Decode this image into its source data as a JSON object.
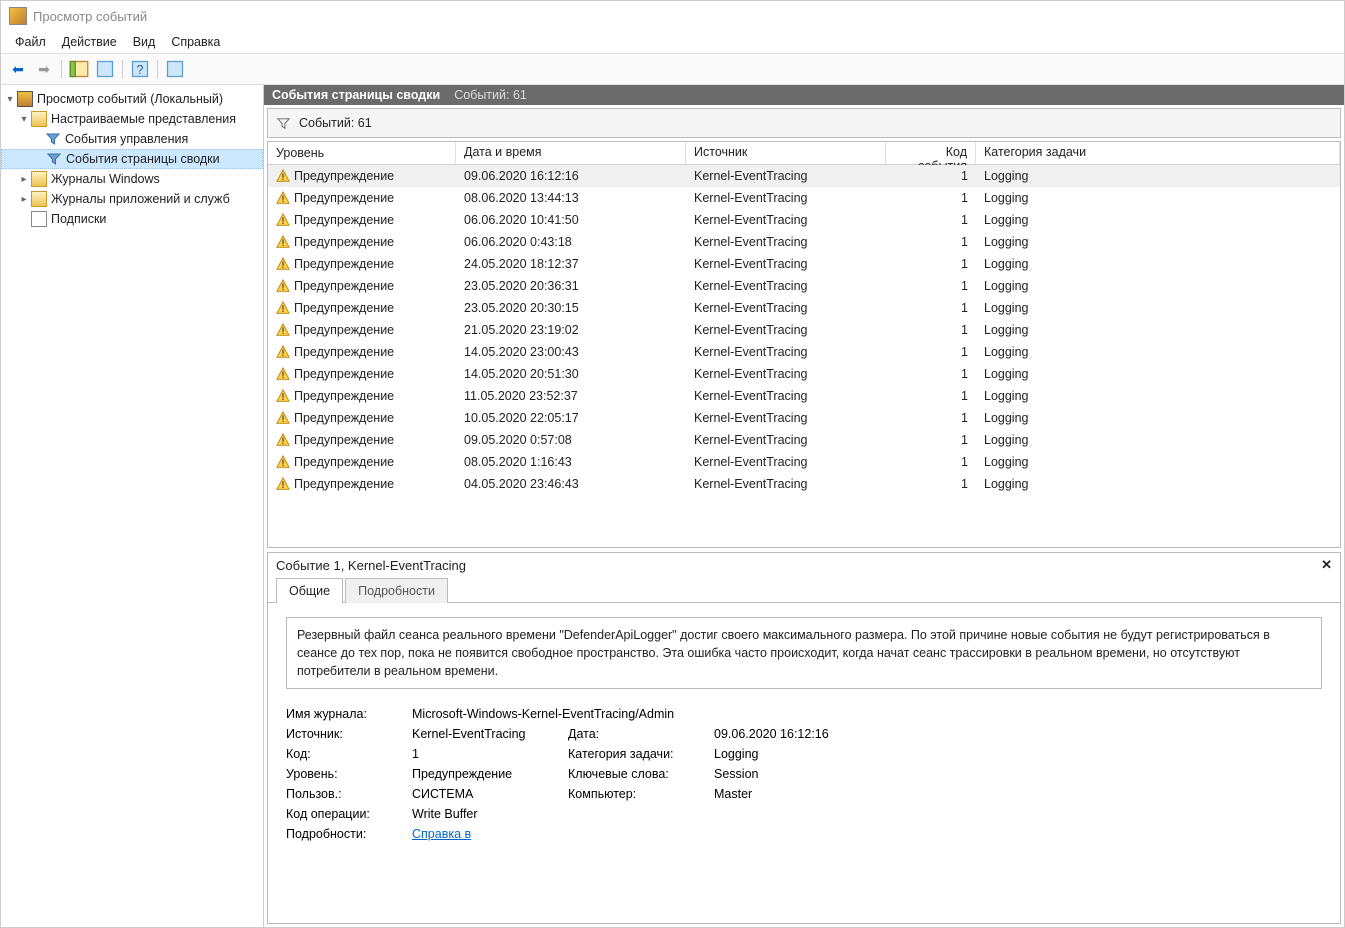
{
  "window_title": "Просмотр событий",
  "menu": [
    "Файл",
    "Действие",
    "Вид",
    "Справка"
  ],
  "tree": {
    "root": "Просмотр событий (Локальный)",
    "custom_views": "Настраиваемые представления",
    "admin_events": "События управления",
    "summary_events": "События страницы сводки",
    "win_logs": "Журналы Windows",
    "app_logs": "Журналы приложений и служб",
    "subscriptions": "Подписки"
  },
  "header": {
    "title": "События страницы сводки",
    "count_label": "Событий: 61"
  },
  "filter_bar_label": "Событий: 61",
  "columns": {
    "level": "Уровень",
    "datetime": "Дата и время",
    "source": "Источник",
    "code": "Код события",
    "category": "Категория задачи"
  },
  "level_warning": "Предупреждение",
  "source_common": "Kernel-EventTracing",
  "cat_common": "Logging",
  "code_common": "1",
  "rows": [
    {
      "dt": "09.06.2020 16:12:16"
    },
    {
      "dt": "08.06.2020 13:44:13"
    },
    {
      "dt": "06.06.2020 10:41:50"
    },
    {
      "dt": "06.06.2020 0:43:18"
    },
    {
      "dt": "24.05.2020 18:12:37"
    },
    {
      "dt": "23.05.2020 20:36:31"
    },
    {
      "dt": "23.05.2020 20:30:15"
    },
    {
      "dt": "21.05.2020 23:19:02"
    },
    {
      "dt": "14.05.2020 23:00:43"
    },
    {
      "dt": "14.05.2020 20:51:30"
    },
    {
      "dt": "11.05.2020 23:52:37"
    },
    {
      "dt": "10.05.2020 22:05:17"
    },
    {
      "dt": "09.05.2020 0:57:08"
    },
    {
      "dt": "08.05.2020 1:16:43"
    },
    {
      "dt": "04.05.2020 23:46:43"
    }
  ],
  "detail": {
    "title": "Событие 1, Kernel-EventTracing",
    "tab_general": "Общие",
    "tab_details": "Подробности",
    "description": "Резервный файл сеанса реального времени \"DefenderApiLogger\" достиг своего максимального размера. По этой причине новые события не будут регистрироваться в сеансе до тех пор, пока не появится свободное пространство. Эта ошибка часто происходит, когда начат сеанс трассировки в реальном времени, но отсутствуют потребители в реальном времени.",
    "labels": {
      "log_name": "Имя журнала:",
      "source": "Источник:",
      "date": "Дата:",
      "code": "Код:",
      "category": "Категория задачи:",
      "level": "Уровень:",
      "keywords": "Ключевые слова:",
      "user": "Пользов.:",
      "computer": "Компьютер:",
      "opcode": "Код операции:",
      "more": "Подробности:"
    },
    "values": {
      "log_name": "Microsoft-Windows-Kernel-EventTracing/Admin",
      "source": "Kernel-EventTracing",
      "date": "09.06.2020 16:12:16",
      "code": "1",
      "category": "Logging",
      "level": "Предупреждение",
      "keywords": "Session",
      "user": "СИСТЕМА",
      "computer": "Master",
      "opcode": "Write Buffer",
      "more_link": "Справка в "
    }
  }
}
